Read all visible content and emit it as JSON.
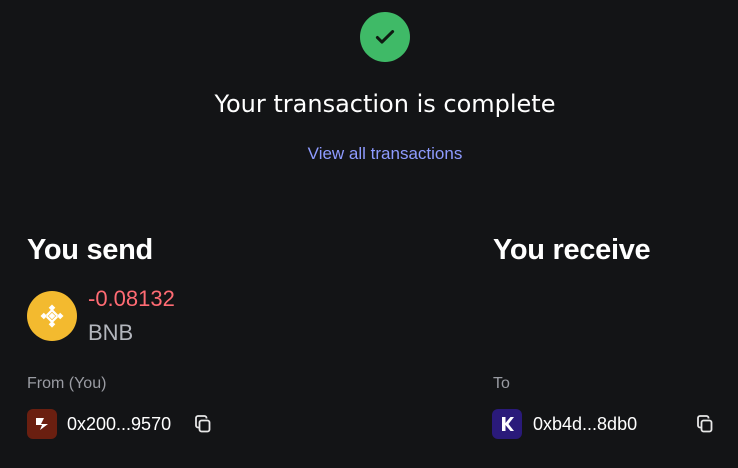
{
  "status": {
    "icon": "check-icon",
    "title": "Your transaction is complete",
    "link_label": "View all transactions",
    "success_color": "#3fba67",
    "link_color": "#8e9bff"
  },
  "send": {
    "heading": "You send",
    "token_icon": "bnb-icon",
    "amount": "-0.08132",
    "symbol": "BNB",
    "amount_color": "#ff6b73",
    "from_label": "From (You)",
    "wallet_icon": "wallet-icon",
    "address": "0x200...9570",
    "copy_icon": "copy-icon"
  },
  "receive": {
    "heading": "You receive",
    "to_label": "To",
    "wallet_icon": "kraken-icon",
    "address": "0xb4d...8db0",
    "copy_icon": "copy-icon"
  }
}
